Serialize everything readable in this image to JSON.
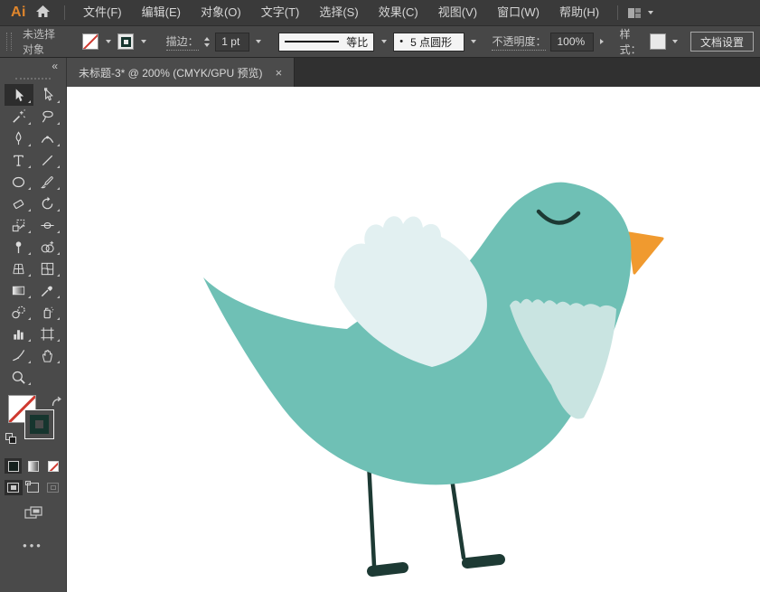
{
  "menu_bar": {
    "logo": "Ai",
    "items": [
      "文件(F)",
      "编辑(E)",
      "对象(O)",
      "文字(T)",
      "选择(S)",
      "效果(C)",
      "视图(V)",
      "窗口(W)",
      "帮助(H)"
    ]
  },
  "control_bar": {
    "status": "未选择对象",
    "stroke_label": "描边：",
    "stroke_weight": "1 pt",
    "width_profile": "等比",
    "brush_bullet": "•",
    "brush_name": "5 点圆形",
    "opacity_label": "不透明度：",
    "opacity_value": "100%",
    "style_label": "样式：",
    "document_setup": "文档设置"
  },
  "document_tab": {
    "title": "未标题-3* @ 200% (CMYK/GPU 预览)",
    "close": "×"
  },
  "toolbar": {
    "collapse": "«",
    "more": "•••",
    "active_tool": "selection-tool",
    "tools": [
      "selection-tool",
      "direct-selection-tool",
      "magic-wand-tool",
      "lasso-tool",
      "pen-tool",
      "curvature-tool",
      "type-tool",
      "line-segment-tool",
      "ellipse-tool",
      "paintbrush-tool",
      "eraser-tool",
      "rotate-tool",
      "scale-tool",
      "width-tool",
      "puppet-warp-tool",
      "shape-builder-tool",
      "perspective-grid-tool",
      "mesh-tool",
      "gradient-tool",
      "eyedropper-tool",
      "blend-tool",
      "symbol-sprayer-tool",
      "column-graph-tool",
      "artboard-tool",
      "slice-tool",
      "hand-tool",
      "zoom-tool"
    ]
  },
  "ui_colors": {
    "accent_logo": "#e0862c",
    "stroke_swatch": "#16352e"
  },
  "artwork": {
    "colors": {
      "body": "#6fc0b5",
      "wing": "#e2f0f1",
      "chest": "#c9e4e1",
      "beak": "#f09a2f",
      "line": "#1d3a34"
    }
  }
}
